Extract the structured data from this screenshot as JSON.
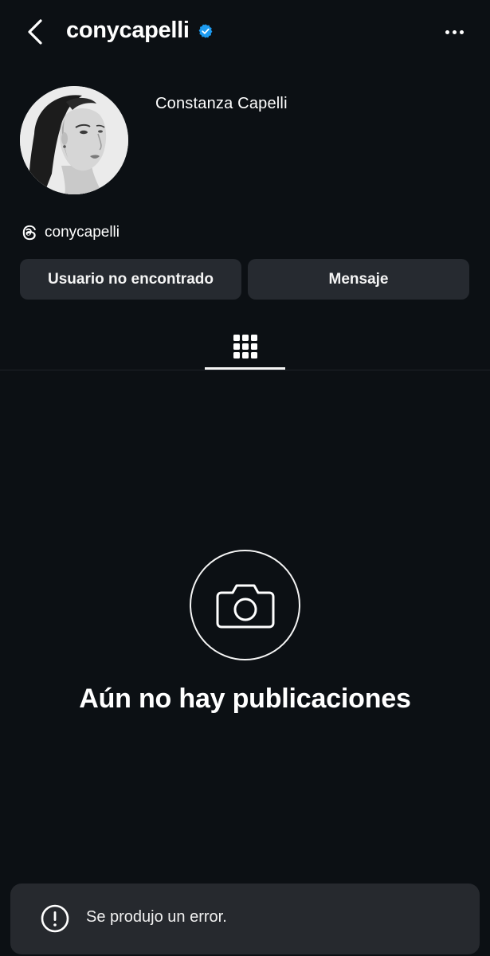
{
  "header": {
    "username": "conycapelli",
    "verified": true,
    "back_icon": "chevron-left-icon",
    "more_icon": "more-horizontal-icon"
  },
  "profile": {
    "display_name": "Constanza Capelli",
    "threads_handle": "conycapelli",
    "threads_icon": "threads-icon",
    "avatar_icon": "profile-photo"
  },
  "actions": {
    "user_button_label": "Usuario no encontrado",
    "message_button_label": "Mensaje"
  },
  "tabs": {
    "active": "grid",
    "grid_icon": "grid-icon"
  },
  "empty_state": {
    "icon": "camera-icon",
    "title": "Aún no hay publicaciones"
  },
  "toast": {
    "icon": "exclamation-circle-icon",
    "message": "Se produjo un error."
  },
  "colors": {
    "background": "#0c1014",
    "button_bg": "#262a30",
    "toast_bg": "#26292e",
    "verified_blue": "#1d9bf0",
    "text": "#ffffff"
  }
}
